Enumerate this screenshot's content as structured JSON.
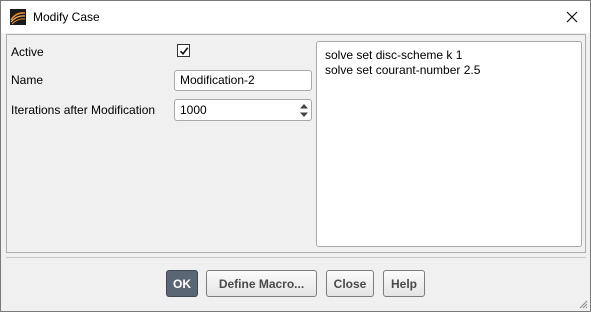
{
  "window": {
    "title": "Modify Case"
  },
  "form": {
    "active_label": "Active",
    "active_checked": true,
    "name_label": "Name",
    "name_value": "Modification-2",
    "iterations_label": "Iterations after Modification",
    "iterations_value": "1000"
  },
  "script": {
    "lines": [
      "solve set disc-scheme k 1",
      "solve set courant-number 2.5"
    ]
  },
  "buttons": {
    "ok": "OK",
    "define_macro": "Define Macro...",
    "close": "Close",
    "help": "Help"
  },
  "colors": {
    "primary_button": "#5a6673",
    "icon_orange": "#e8892a"
  },
  "icons": {
    "app": "fluent-app-icon",
    "close": "close-icon",
    "check": "checkmark-icon",
    "spin": "spin-arrows-icon",
    "grip": "resize-grip-icon"
  }
}
